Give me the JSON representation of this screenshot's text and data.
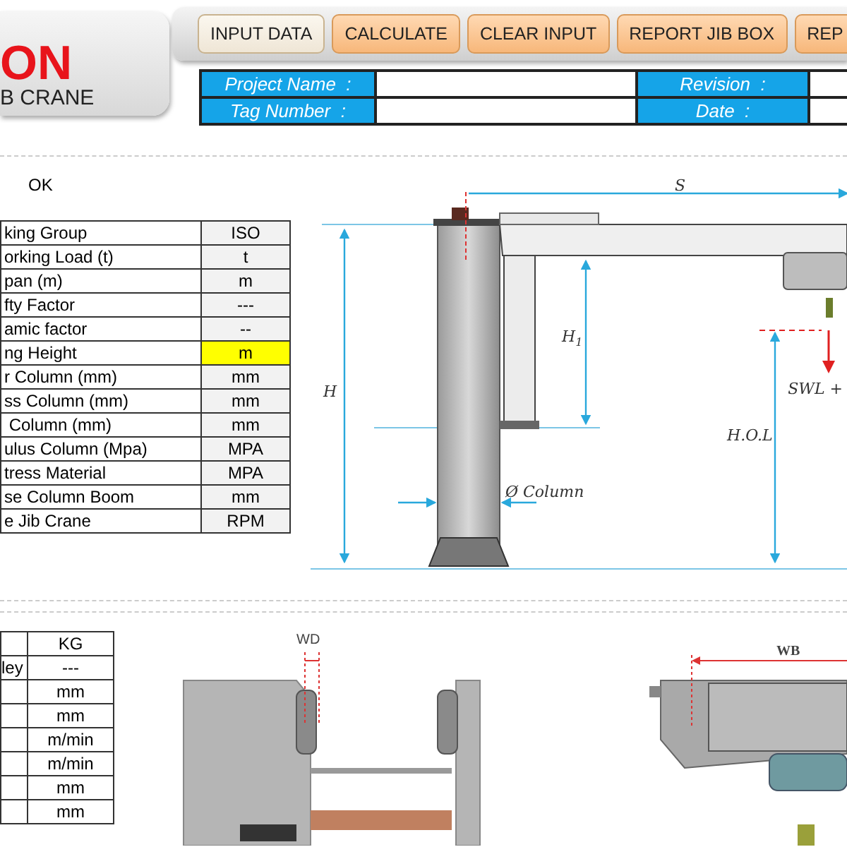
{
  "logo": {
    "title": "ON",
    "subtitle": "B CRANE"
  },
  "toolbar": {
    "buttons": [
      {
        "label": "INPUT DATA",
        "selected": true
      },
      {
        "label": "CALCULATE",
        "selected": false
      },
      {
        "label": "CLEAR INPUT",
        "selected": false
      },
      {
        "label": "REPORT JIB BOX",
        "selected": false
      },
      {
        "label": "REP",
        "selected": false
      }
    ]
  },
  "project_info": {
    "fields": [
      {
        "label": "Project Name  :"
      },
      {
        "label": "Revision  :"
      },
      {
        "label": "Tag Number  :"
      },
      {
        "label": "Date  :"
      }
    ]
  },
  "status": "OK",
  "parameters": [
    {
      "name": "king Group",
      "unit": "ISO",
      "highlighted": false
    },
    {
      "name": "orking Load (t)",
      "unit": "t",
      "highlighted": false
    },
    {
      "name": "pan (m)",
      "unit": "m",
      "highlighted": false
    },
    {
      "name": "fty Factor",
      "unit": "---",
      "highlighted": false
    },
    {
      "name": "amic factor",
      "unit": "--",
      "highlighted": false
    },
    {
      "name": "ng Height",
      "unit": "m",
      "highlighted": true
    },
    {
      "name": "r Column (mm)",
      "unit": "mm",
      "highlighted": false
    },
    {
      "name": "ss Column (mm)",
      "unit": "mm",
      "highlighted": false
    },
    {
      "name": " Column (mm)",
      "unit": "mm",
      "highlighted": false
    },
    {
      "name": "ulus Column (Mpa)",
      "unit": "MPA",
      "highlighted": false
    },
    {
      "name": "tress Material",
      "unit": "MPA",
      "highlighted": false
    },
    {
      "name": "se Column Boom",
      "unit": "mm",
      "highlighted": false
    },
    {
      "name": "e Jib Crane",
      "unit": "RPM",
      "highlighted": false
    }
  ],
  "crane_diagram": {
    "span_label": "S",
    "height_label": "H",
    "boom_height_label": "H$_{1}$",
    "hook_height_label": "H.O.L",
    "load_label": "SWL +",
    "column_label": "Ø Column"
  },
  "trolley_table": [
    {
      "unit": "KG"
    },
    {
      "name": "ley",
      "unit": "---"
    },
    {
      "unit": "mm"
    },
    {
      "unit": "mm"
    },
    {
      "unit": "m/min"
    },
    {
      "unit": "m/min"
    },
    {
      "unit": "mm"
    },
    {
      "unit": "mm"
    }
  ],
  "wheel_drawing": {
    "label": "WD"
  },
  "trolley_drawing": {
    "label": "WB"
  }
}
